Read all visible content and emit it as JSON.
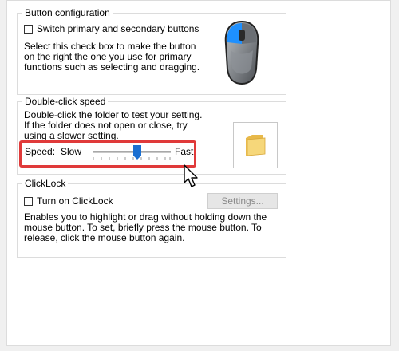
{
  "button_configuration": {
    "title": "Button configuration",
    "switch_label": "Switch primary and secondary buttons",
    "switch_checked": false,
    "description": "Select this check box to make the button on the right the one you use for primary functions such as selecting and dragging."
  },
  "double_click_speed": {
    "title": "Double-click speed",
    "description": "Double-click the folder to test your setting. If the folder does not open or close, try using a slower setting.",
    "speed_label": "Speed:",
    "slow_label": "Slow",
    "fast_label": "Fast",
    "slider_value_fraction": 0.58
  },
  "clicklock": {
    "title": "ClickLock",
    "turn_on_label": "Turn on ClickLock",
    "turn_on_checked": false,
    "settings_button": "Settings...",
    "description": "Enables you to highlight or drag without holding down the mouse button. To set, briefly press the mouse button. To release, click the mouse button again."
  },
  "colors": {
    "highlight": "#e03a3a",
    "slider_thumb": "#1a6fd1",
    "mouse_blue": "#1e90ff"
  },
  "icons": [
    "mouse-image",
    "folder-icon",
    "mouse-pointer-icon"
  ]
}
